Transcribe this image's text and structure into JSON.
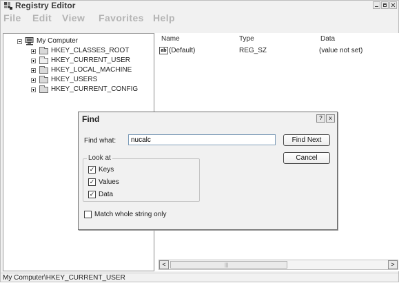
{
  "window": {
    "title": "Registry Editor",
    "icon": "registry-editor-icon"
  },
  "menu": [
    "File",
    "Edit",
    "View",
    "Favorites",
    "Help"
  ],
  "tree": {
    "root": "My Computer",
    "keys": [
      "HKEY_CLASSES_ROOT",
      "HKEY_CURRENT_USER",
      "HKEY_LOCAL_MACHINE",
      "HKEY_USERS",
      "HKEY_CURRENT_CONFIG"
    ],
    "selected": "HKEY_CURRENT_USER"
  },
  "list": {
    "columns": [
      "Name",
      "Type",
      "Data"
    ],
    "rows": [
      {
        "name": "(Default)",
        "type": "REG_SZ",
        "data": "(value not set)",
        "icon": "ab"
      }
    ]
  },
  "scrollbar": {
    "left_arrow": "<",
    "right_arrow": ">",
    "grip": "|||"
  },
  "status": {
    "path": "My Computer\\HKEY_CURRENT_USER"
  },
  "find_dialog": {
    "title": "Find",
    "help_button": "?",
    "close_button": "x",
    "find_what_label": "Find what:",
    "find_what_value": "nucalc",
    "find_next_label": "Find Next",
    "cancel_label": "Cancel",
    "look_at_label": "Look at",
    "options": [
      {
        "label": "Keys",
        "checked": true
      },
      {
        "label": "Values",
        "checked": true
      },
      {
        "label": "Data",
        "checked": true
      }
    ],
    "match_whole_label": "Match whole string only",
    "match_whole_checked": false
  }
}
